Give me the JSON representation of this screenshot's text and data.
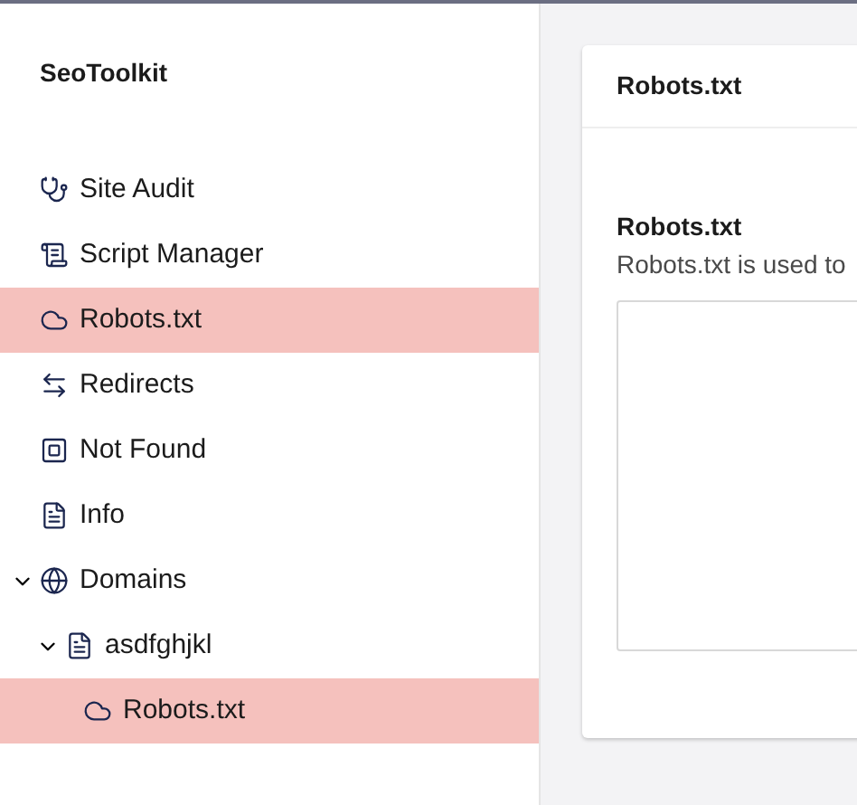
{
  "sidebar": {
    "title": "SeoToolkit",
    "items": [
      {
        "label": "Site Audit",
        "selected": false
      },
      {
        "label": "Script Manager",
        "selected": false
      },
      {
        "label": "Robots.txt",
        "selected": true
      },
      {
        "label": "Redirects",
        "selected": false
      },
      {
        "label": "Not Found",
        "selected": false
      },
      {
        "label": "Info",
        "selected": false
      },
      {
        "label": "Domains",
        "selected": false,
        "expanded": true,
        "children": [
          {
            "label": "asdfghjkl",
            "selected": false,
            "expanded": true,
            "children": [
              {
                "label": "Robots.txt",
                "selected": true
              }
            ]
          }
        ]
      }
    ]
  },
  "panel": {
    "title": "Robots.txt",
    "field": {
      "label": "Robots.txt",
      "description": "Robots.txt is used to"
    }
  }
}
